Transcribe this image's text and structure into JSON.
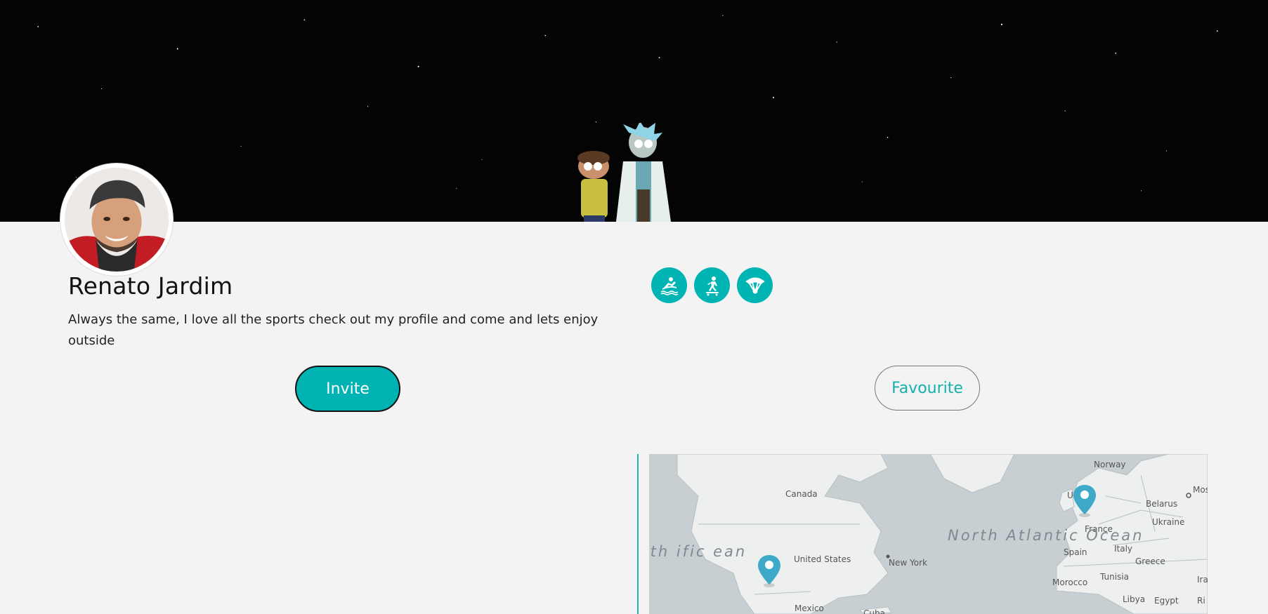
{
  "profile": {
    "name": "Renato Jardim",
    "bio": "Always the same, I love all the sports check out my profile and come and lets enjoy outside"
  },
  "sports": [
    {
      "icon": "surfing-icon"
    },
    {
      "icon": "skateboarding-icon"
    },
    {
      "icon": "paragliding-icon"
    }
  ],
  "actions": {
    "invite_label": "Invite",
    "favourite_label": "Favourite"
  },
  "map": {
    "labels": {
      "norway": "Norway",
      "canada": "Canada",
      "united_kingdom": "United Kingdom",
      "belarus": "Belarus",
      "moscow": "Mos",
      "france": "France",
      "ukraine": "Ukraine",
      "north_atlantic": "North Atlantic Ocean",
      "pacific": "rth ific ean",
      "united_states": "United States",
      "new_york": "New York",
      "spain": "Spain",
      "italy": "Italy",
      "greece": "Greece",
      "morocco": "Morocco",
      "tunisia": "Tunisia",
      "iran": "Ira",
      "libya": "Libya",
      "egypt": "Egypt",
      "ri": "Ri",
      "mexico": "Mexico",
      "cuba": "Cuba"
    },
    "pins": [
      "London",
      "Los Angeles"
    ]
  },
  "colors": {
    "accent": "#00b4b4",
    "background": "#f3f3f3",
    "pin": "#3fa9c9"
  }
}
